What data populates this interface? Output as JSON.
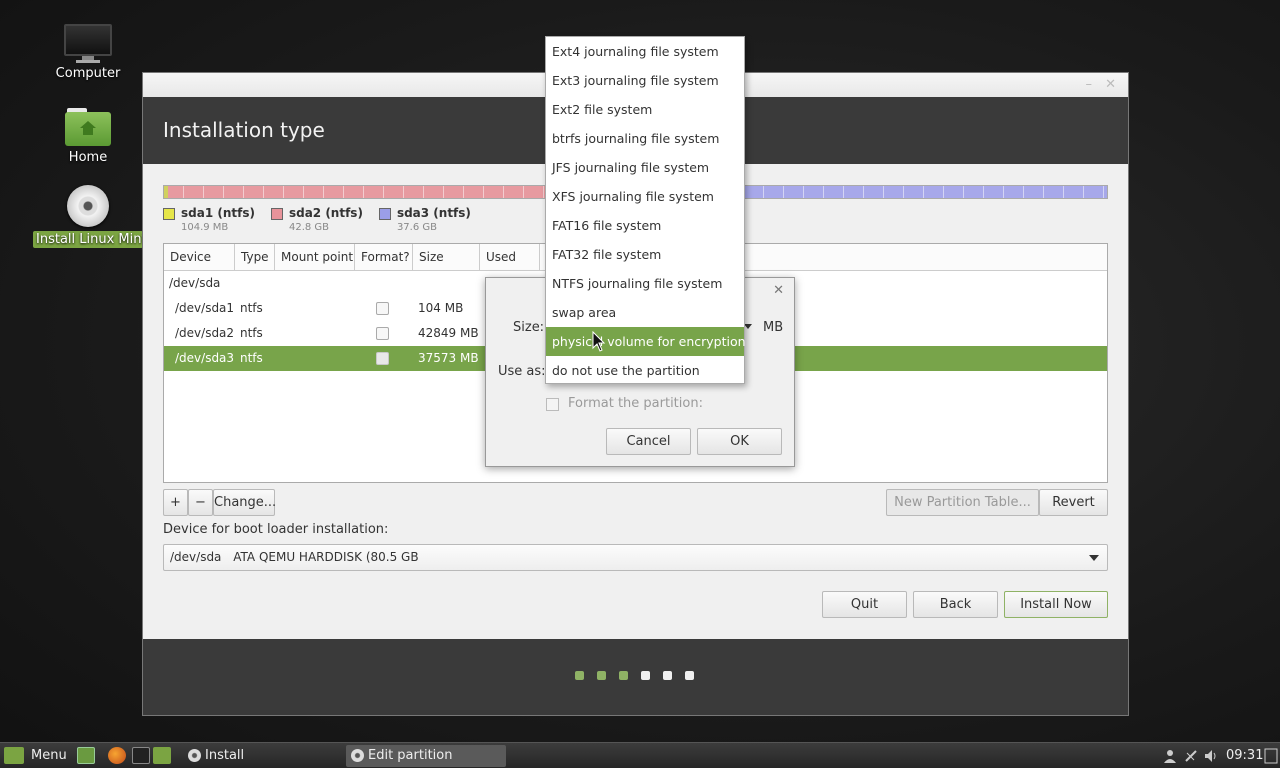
{
  "desktop": {
    "icons": [
      {
        "label": "Computer"
      },
      {
        "label": "Home"
      },
      {
        "label": "Install Linux Mint"
      }
    ]
  },
  "window": {
    "minimize": "–",
    "close": "✕",
    "title": "Installation type"
  },
  "partitions_legend": [
    {
      "name": "sda1 (ntfs)",
      "size": "104.9 MB",
      "color": "#e6e64a"
    },
    {
      "name": "sda2 (ntfs)",
      "size": "42.8 GB",
      "color": "#e8939a"
    },
    {
      "name": "sda3 (ntfs)",
      "size": "37.6 GB",
      "color": "#9b9ee8"
    }
  ],
  "table": {
    "headers": [
      "Device",
      "Type",
      "Mount point",
      "Format?",
      "Size",
      "Used"
    ],
    "rows": [
      {
        "device": "/dev/sda",
        "type": "",
        "size": ""
      },
      {
        "device": "/dev/sda1",
        "type": "ntfs",
        "size": "104 MB"
      },
      {
        "device": "/dev/sda2",
        "type": "ntfs",
        "size": "42849 MB"
      },
      {
        "device": "/dev/sda3",
        "type": "ntfs",
        "size": "37573 MB"
      }
    ]
  },
  "toolbar": {
    "add": "+",
    "remove": "−",
    "change": "Change...",
    "new_table": "New Partition Table...",
    "revert": "Revert"
  },
  "bootloader": {
    "label": "Device for boot loader installation:",
    "device": "/dev/sda",
    "desc": "ATA QEMU HARDDISK (80.5 GB"
  },
  "buttons": {
    "quit": "Quit",
    "back": "Back",
    "install": "Install Now"
  },
  "progress_dots": {
    "total": 6,
    "completed": 3,
    "colors": {
      "done": "#8fb265",
      "todo": "#f0f0f0"
    }
  },
  "dialog": {
    "close": "✕",
    "size_label": "Size:",
    "size_unit": "MB",
    "use_as_label": "Use as:",
    "format_label": "Format the partition:",
    "cancel": "Cancel",
    "ok": "OK"
  },
  "use_as_menu": {
    "items": [
      "Ext4 journaling file system",
      "Ext3 journaling file system",
      "Ext2 file system",
      "btrfs journaling file system",
      "JFS journaling file system",
      "XFS journaling file system",
      "FAT16 file system",
      "FAT32 file system",
      "NTFS journaling file system",
      "swap area",
      "physical volume for encryption",
      "do not use the partition"
    ],
    "highlighted_index": 10
  },
  "taskbar": {
    "menu": "Menu",
    "tasks": [
      {
        "label": "Install",
        "active": false
      },
      {
        "label": "Edit partition",
        "active": true
      }
    ],
    "clock": "09:31"
  },
  "accent": "#78a44a"
}
